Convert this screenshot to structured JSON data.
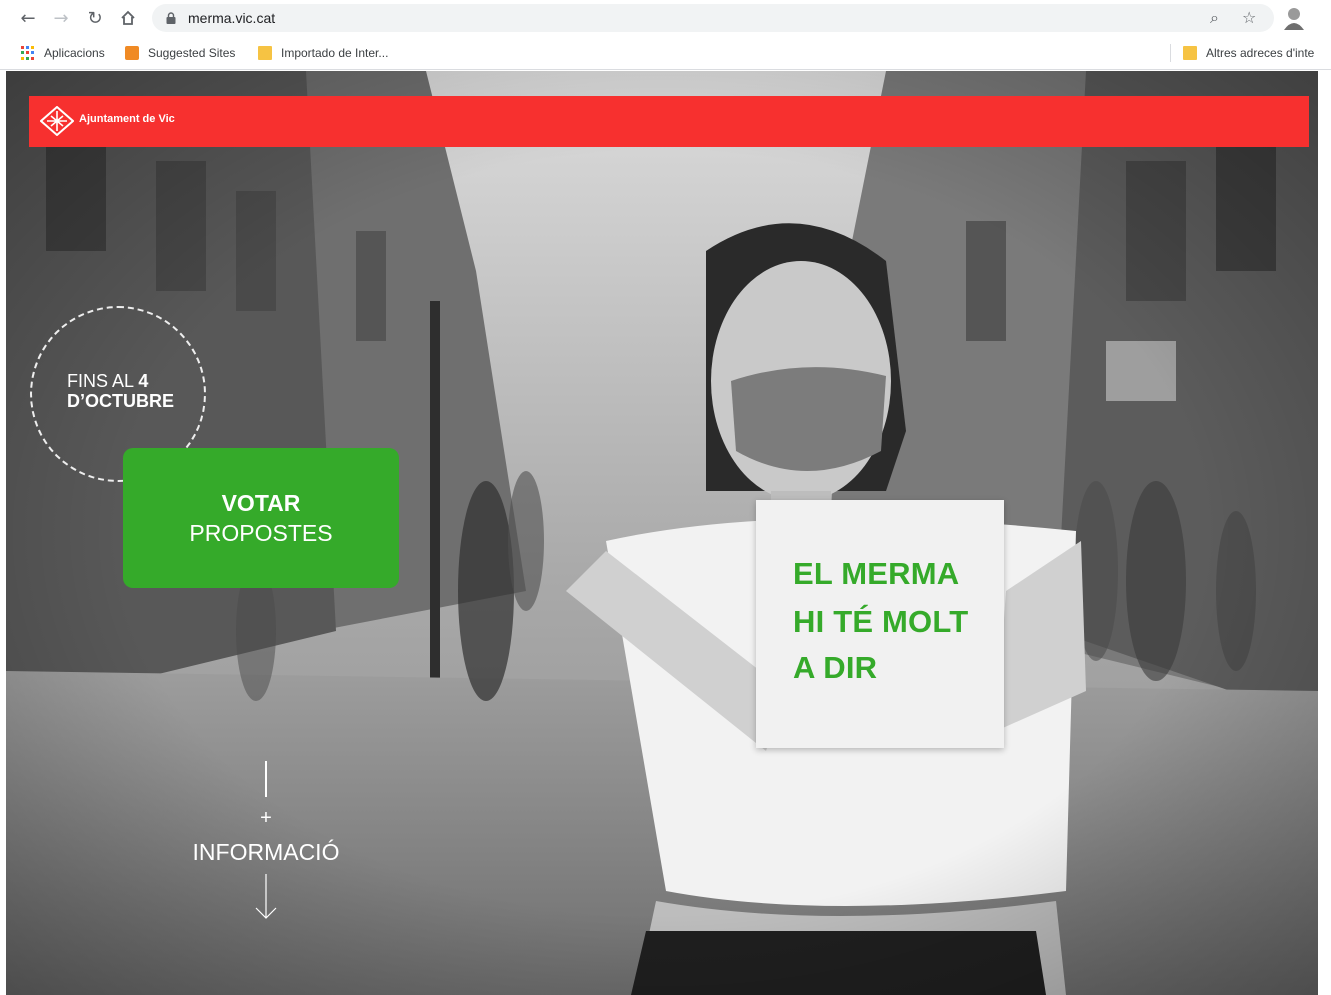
{
  "browser": {
    "url": "merma.vic.cat",
    "nav_icons": [
      "back-arrow-icon",
      "forward-arrow-icon",
      "reload-icon",
      "home-icon"
    ],
    "bookmarks": [
      {
        "label": "Aplicacions",
        "icon": "apps-grid-icon"
      },
      {
        "label": "Suggested Sites",
        "icon": "suggested-sites-icon"
      },
      {
        "label": "Importado de Inter...",
        "icon": "folder-icon"
      }
    ],
    "other_bookmarks": "Altres adreces d'inte"
  },
  "page": {
    "brand": {
      "name": "Ajuntament de Vic",
      "color": "#f7302f"
    },
    "date_badge": {
      "prefix": "FINS AL ",
      "day": "4",
      "month": "D’OCTUBRE"
    },
    "vote_button": {
      "line1": "VOTAR",
      "line2": "PROPOSTES",
      "color": "#35aa2a"
    },
    "info": {
      "plus": "+",
      "label": "INFORMACIÓ"
    },
    "sign": {
      "lines": [
        "EL MERMA",
        "HI TÉ MOLT",
        "A DIR"
      ],
      "color": "#35aa2a"
    }
  }
}
